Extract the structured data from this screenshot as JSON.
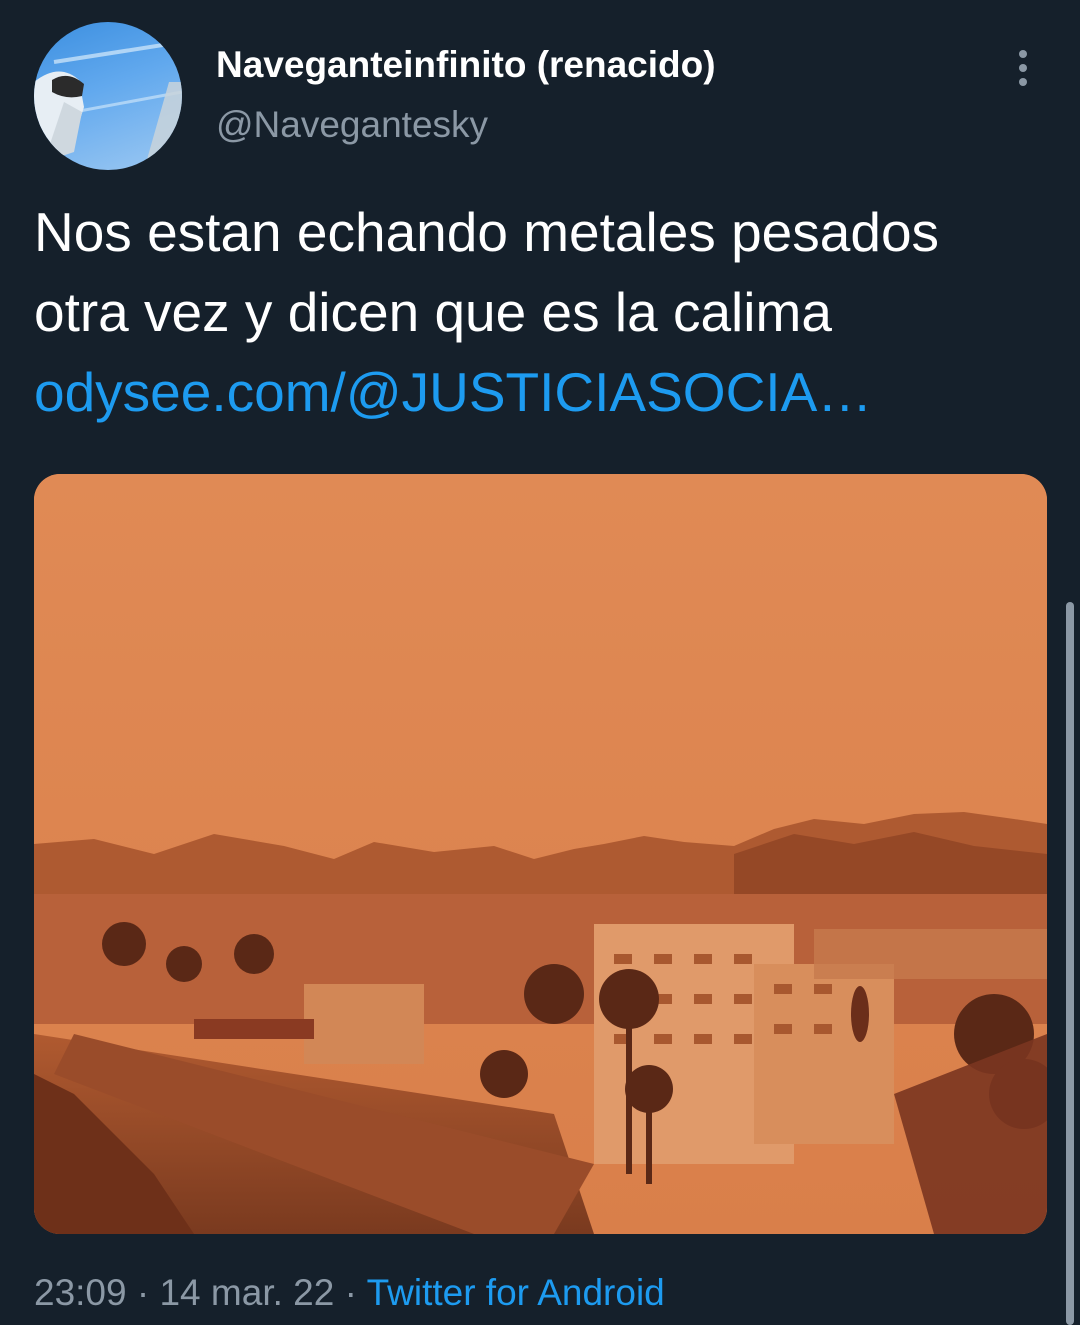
{
  "tweet": {
    "author": {
      "display_name": "Naveganteinfinito (renacido)",
      "handle": "@Navegantesky"
    },
    "text_lines": [
      "Nos estan echando metales pesados",
      "otra vez y dicen que es la calima"
    ],
    "link_text": "odysee.com/@JUSTICIASOCIA…",
    "time": "23:09",
    "separator": "·",
    "date": "14 mar. 22",
    "source": "Twitter for Android"
  },
  "icons": {
    "more": "more-vertical-icon"
  },
  "colors": {
    "background": "#15202b",
    "link": "#1d9bf0",
    "secondary_text": "#8b98a5"
  }
}
